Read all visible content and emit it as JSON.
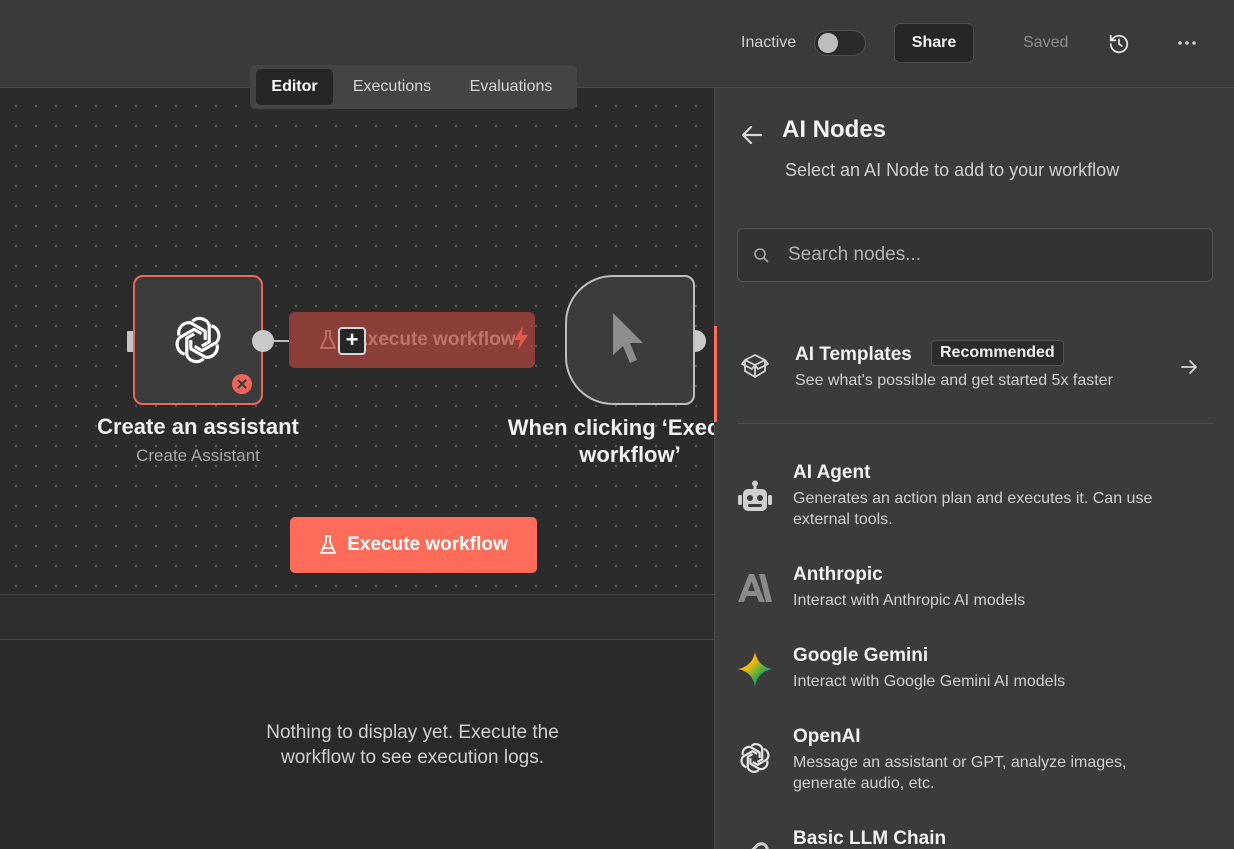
{
  "header": {
    "status_label": "Inactive",
    "share_label": "Share",
    "saved_label": "Saved"
  },
  "tabs": [
    {
      "label": "Editor",
      "active": true
    },
    {
      "label": "Executions",
      "active": false
    },
    {
      "label": "Evaluations",
      "active": false
    }
  ],
  "canvas": {
    "node_assistant": {
      "title": "Create an assistant",
      "subtitle": "Create Assistant"
    },
    "ghost_button_label": "Execute workflow",
    "node_trigger": {
      "title_line1": "When clicking ‘Execute",
      "title_line2": "workflow’"
    },
    "execute_button_label": "Execute workflow"
  },
  "logs": {
    "empty_line1": "Nothing to display yet. Execute the",
    "empty_line2": "workflow to see execution logs."
  },
  "panel": {
    "title": "AI Nodes",
    "subtitle": "Select an AI Node to add to your workflow",
    "search_placeholder": "Search nodes...",
    "templates": {
      "title": "AI Templates",
      "badge": "Recommended",
      "description": "See what's possible and get started 5x faster"
    },
    "items": [
      {
        "title": "AI Agent",
        "description": "Generates an action plan and executes it. Can use external tools.",
        "icon": "robot-icon"
      },
      {
        "title": "Anthropic",
        "description": "Interact with Anthropic AI models",
        "icon": "anthropic-icon"
      },
      {
        "title": "Google Gemini",
        "description": "Interact with Google Gemini AI models",
        "icon": "gemini-icon"
      },
      {
        "title": "OpenAI",
        "description": "Message an assistant or GPT, analyze images, generate audio, etc.",
        "icon": "openai-icon"
      },
      {
        "title": "Basic LLM Chain",
        "description": "",
        "icon": "link-icon"
      }
    ]
  },
  "colors": {
    "accent": "#ff6d5a",
    "error": "#f0645a",
    "background": "#2b2b2b",
    "panel": "#3b3b3b"
  }
}
